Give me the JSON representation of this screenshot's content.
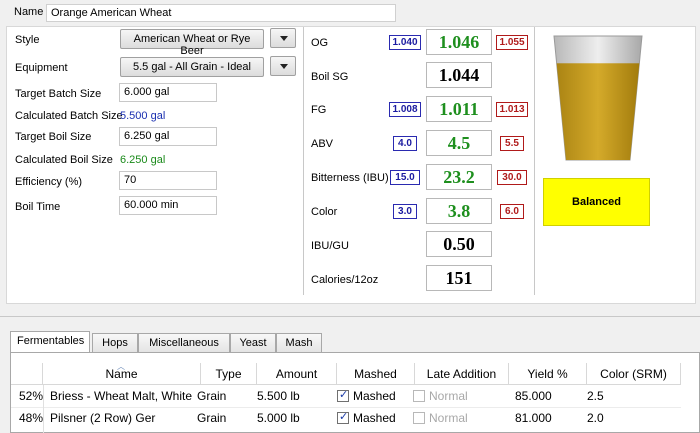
{
  "recipe": {
    "name_label": "Name",
    "name_value": "Orange American Wheat"
  },
  "left_form": {
    "style_label": "Style",
    "style_value": "American Wheat or Rye Beer",
    "equipment_label": "Equipment",
    "equipment_value": "5.5 gal - All Grain - Ideal",
    "target_batch_label": "Target Batch Size",
    "target_batch_value": "6.000 gal",
    "calc_batch_label": "Calculated Batch Size",
    "calc_batch_value": "5.500 gal",
    "target_boil_label": "Target Boil Size",
    "target_boil_value": "6.250 gal",
    "calc_boil_label": "Calculated Boil Size",
    "calc_boil_value": "6.250 gal",
    "efficiency_label": "Efficiency (%)",
    "efficiency_value": "70",
    "boil_time_label": "Boil Time",
    "boil_time_value": "60.000 min"
  },
  "stats": {
    "og": {
      "label": "OG",
      "min": "1.040",
      "value": "1.046",
      "max": "1.055"
    },
    "boil_sg": {
      "label": "Boil SG",
      "value": "1.044"
    },
    "fg": {
      "label": "FG",
      "min": "1.008",
      "value": "1.011",
      "max": "1.013"
    },
    "abv": {
      "label": "ABV",
      "min": "4.0",
      "value": "4.5",
      "max": "5.5"
    },
    "ibu": {
      "label": "Bitterness (IBU)",
      "min": "15.0",
      "value": "23.2",
      "max": "30.0"
    },
    "color": {
      "label": "Color",
      "min": "3.0",
      "value": "3.8",
      "max": "6.0"
    },
    "ibu_gu": {
      "label": "IBU/GU",
      "value": "0.50"
    },
    "calories": {
      "label": "Calories/12oz",
      "value": "151"
    }
  },
  "glass": {
    "beer_color": "#c9a01a",
    "fill_level": 0.78
  },
  "balance": {
    "label": "Balanced",
    "color": "#ffff00"
  },
  "tabs": [
    "Fermentables",
    "Hops",
    "Miscellaneous",
    "Yeast",
    "Mash"
  ],
  "table": {
    "columns": [
      "Name",
      "Type",
      "Amount",
      "Mashed",
      "Late Addition",
      "Yield %",
      "Color (SRM)"
    ],
    "rows": [
      {
        "pct": "52%",
        "name": "Briess - Wheat Malt, White",
        "type": "Grain",
        "amount": "5.500 lb",
        "mashed": "Mashed",
        "late": "Normal",
        "yield": "85.000",
        "color": "2.5"
      },
      {
        "pct": "48%",
        "name": "Pilsner (2 Row) Ger",
        "type": "Grain",
        "amount": "5.000 lb",
        "mashed": "Mashed",
        "late": "Normal",
        "yield": "81.000",
        "color": "2.0"
      }
    ]
  }
}
